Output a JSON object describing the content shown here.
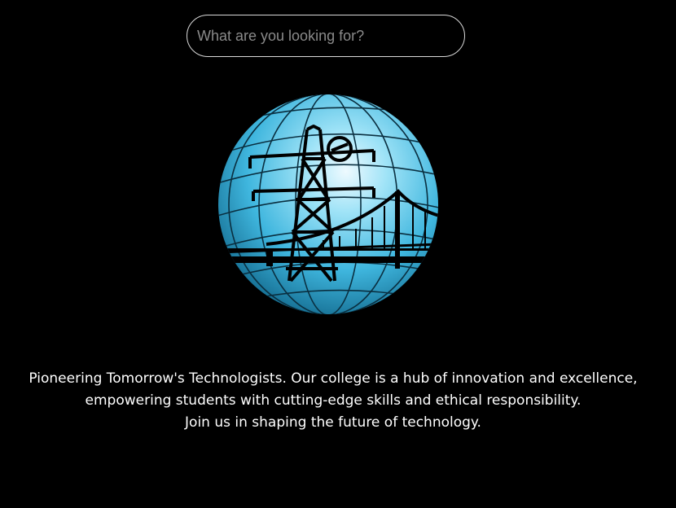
{
  "search": {
    "placeholder": "What are you looking for?"
  },
  "logo": {
    "icon": "globe-tower-bridge-logo",
    "colors": {
      "globe_light": "#cdeffb",
      "globe_mid": "#4fc3e6",
      "globe_dark": "#0a5b7e",
      "line": "#000000"
    }
  },
  "tagline": {
    "line1": "Pioneering Tomorrow's Technologists. Our college is a hub of innovation and excellence,",
    "line2": "empowering students with cutting-edge skills and ethical responsibility.",
    "line3": "Join us in shaping the future of technology."
  },
  "colors": {
    "background": "#000000",
    "text": "#ffffff",
    "search_border": "#d9d9d9",
    "placeholder": "#8a8a8a"
  }
}
